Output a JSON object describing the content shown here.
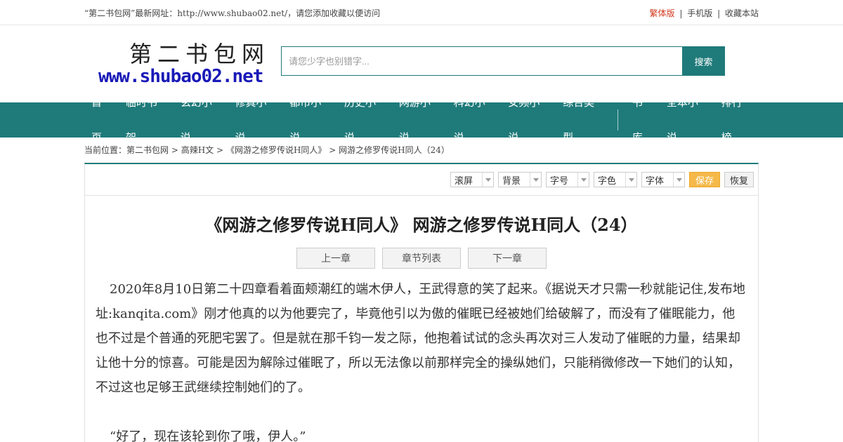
{
  "topbar": {
    "notice": "“第二书包网”最新网址：http://www.shubao02.net/，请您添加收藏以便访问",
    "traditional": "繁体版",
    "sep1": "|",
    "mobile": "手机版",
    "sep2": "|",
    "bookmark": "收藏本站"
  },
  "logo": {
    "cn": "第二书包网",
    "en": "www.shubao02.net"
  },
  "search": {
    "placeholder": "请您少字也别错字...",
    "button": "搜索"
  },
  "nav": {
    "items": [
      "首页",
      "临时书架",
      "玄幻小说",
      "修真小说",
      "都市小说",
      "历史小说",
      "网游小说",
      "科幻小说",
      "女频小说",
      "综合类型"
    ],
    "items2": [
      "书库",
      "全本小说",
      "排行榜"
    ]
  },
  "breadcrumb": {
    "prefix": "当前位置：",
    "site": "第二书包网",
    "sep": ">",
    "category": "高辣H文",
    "book": "《网游之修罗传说H同人》",
    "chapter": "网游之修罗传说H同人（24）"
  },
  "toolbar": {
    "scroll": "滚屏",
    "background": "背景",
    "fontsize": "字号",
    "fontcolor": "字色",
    "font": "字体",
    "save": "保存",
    "reset": "恢复"
  },
  "chapter": {
    "title": "《网游之修罗传说H同人》 网游之修罗传说H同人（24）",
    "prev": "上一章",
    "list": "章节列表",
    "next": "下一章",
    "paragraphs": [
      "2020年8月10日第二十四章看着面颊潮红的端木伊人，王武得意的笑了起来。《据说天才只需一秒就能记住,发布地址:kanqita.com》刚才他真的以为他要完了，毕竟他引以为傲的催眠已经被她们给破解了，而没有了催眠能力，他也不过是个普通的死肥宅罢了。但是就在那千钧一发之际，他抱着试试的念头再次对三人发动了催眠的力量，结果却让他十分的惊喜。可能是因为解除过催眠了，所以无法像以前那样完全的操纵她们，只能稍微修改一下她们的认知，不过这也足够王武继续控制她们的了。",
      "“好了，现在该轮到你了哦，伊人。”"
    ]
  }
}
